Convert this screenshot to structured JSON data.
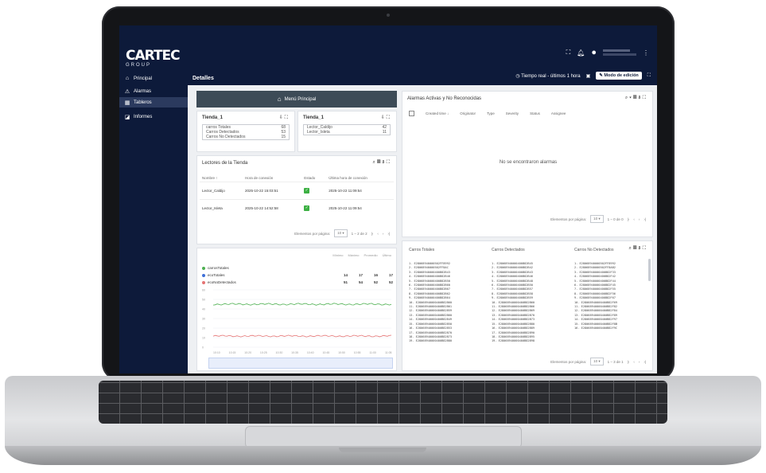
{
  "brand": {
    "word": "CARTEC",
    "sub": "GROUP"
  },
  "sidebar": {
    "items": [
      {
        "label": "Principal",
        "icon": "home-icon",
        "glyph": "⌂"
      },
      {
        "label": "Alarmas",
        "icon": "warning-icon",
        "glyph": "⚠"
      },
      {
        "label": "Tableros",
        "icon": "dashboard-icon",
        "glyph": "▦"
      },
      {
        "label": "Informes",
        "icon": "report-icon",
        "glyph": "◪"
      }
    ],
    "active_index": 2
  },
  "topbar": {
    "page_title": "Detalles",
    "realtime": "Tiempo real - últimos 1 hora",
    "edit_mode": "Modo de edición"
  },
  "menu_button": "Menú Principal",
  "tienda1": {
    "title": "Tienda_1",
    "rows": [
      {
        "k": "carros Totales",
        "v": "68"
      },
      {
        "k": "Carros Detectados",
        "v": "53"
      },
      {
        "k": "Carros No Detectados",
        "v": "15"
      }
    ]
  },
  "tienda2": {
    "title": "Tienda_1",
    "rows": [
      {
        "k": "Lector_Caldijo",
        "v": "42"
      },
      {
        "k": "Lector_Isleta",
        "v": "11"
      }
    ]
  },
  "readers": {
    "title": "Lectores de la Tienda",
    "headers": [
      "Nombre ↑",
      "Hora de conexión",
      "Estado",
      "Última hora de conexión"
    ],
    "rows": [
      {
        "name": "Lector_Caldijo",
        "conn": "2025-10-22 15:03:51",
        "last": "2025-10-22 11:09:54"
      },
      {
        "name": "Lector_Isleta",
        "conn": "2025-10-22 14:52:58",
        "last": "2025-10-22 11:09:54"
      }
    ],
    "per_page_label": "Elementos por página:",
    "per_page": "10",
    "range": "1 – 2 de 2"
  },
  "timeseries": {
    "stats_headers": [
      "Mínimo",
      "Máximo",
      "Promedio",
      "Último"
    ],
    "series": [
      {
        "name": "carrosTotales",
        "color": "#4caf50",
        "stats": [
          "",
          "",
          "",
          ""
        ]
      },
      {
        "name": "ecoTotales",
        "color": "#3f6fd8",
        "stats": [
          "14",
          "17",
          "16",
          "17"
        ]
      },
      {
        "name": "ecoNoDetectados",
        "color": "#e57373",
        "stats": [
          "51",
          "54",
          "52",
          "52"
        ]
      }
    ],
    "y_ticks": [
      "60",
      "50",
      "40",
      "30",
      "20",
      "10",
      "0"
    ],
    "x_ticks": [
      "10:10",
      "10:15",
      "10:20",
      "10:25",
      "10:30",
      "10:35",
      "10:40",
      "10:45",
      "10:50",
      "10:55",
      "11:00",
      "11:05"
    ]
  },
  "alarms": {
    "title": "Alarmas Activas y No Reconocidas",
    "headers": [
      "Created time ↓",
      "Originator",
      "Type",
      "Severity",
      "Status",
      "Assignee"
    ],
    "empty": "No se encontraron alarmas",
    "per_page_label": "Elementos por página:",
    "per_page": "10",
    "range": "1 – 0 de 0"
  },
  "carlist": {
    "headers": [
      "Carros Totales",
      "Carros Detectados",
      "Carros No Detectados"
    ],
    "col1": "1. E28068940000502FF8992\n2. E28068940000502FF8AC\n3. E28068940000400B82B43\n4. E28068940000400B82B46\n5. E28068940000400B82B50\n6. E28068940000400B82B60\n7. E28068940000400B82B67\n8. E28068940000400B82B62\n9. E28068940000400B82B64\n10. E28068940000400B82B60\n11. E28068940000400B82B61\n12. E28068940000400B82B59\n13. E28068940000400B82B60\n14. E28068940000400B82B49\n15. E28068940000400B82B50\n16. E28068940000400B82B53\n17. E28068940000400B82B70\n18. E28068940000400B82B73\n19. E28068940000400B82B80",
    "col2": "1. E28068940000400B82B45\n2. E28068940000400B82B42\n3. E28068940000400B82B43\n4. E28068940000400B82B46\n5. E28068940000400B82B48\n6. E28068940000400B82B50\n7. E28068940000400B82B57\n8. E28068940000400B82B58\n9. E28068940000400B82B59\n10. E28068940000400B82B60\n11. E28068940000400B82B66\n12. E28068940000400B82B69\n13. E28068940000400B82B70\n14. E28068940000400B82B73\n15. E28068940000400B82B80\n16. E28068940000400B82B89\n17. E28068940000400B82B90\n18. E28068940000400B82B95\n19. E28068940000400B82B98",
    "col3": "1. E28068940000502FF8992\n2. E28068940000502FF8AB2\n3. E28068940000400B82F33\n4. E28068940000400B82F42\n5. E28068940000400B82F44\n6. E28068940000400B82F45\n7. E28068940000400B82F55\n8. E28068940000400B82F56\n9. E28068940000400B82F67\n10. E28068940000400B82F69\n11. E28068940000400B82F82\n12. E28068940000400B82F84\n13. E28068940000400B82F89\n14. E28068940000400B82F97\n15. E28068940000400B82F8B\n16. E28068940000400B82F9C",
    "per_page_label": "Elementos por página:",
    "per_page": "10",
    "range": "1 – 3 de 1"
  }
}
